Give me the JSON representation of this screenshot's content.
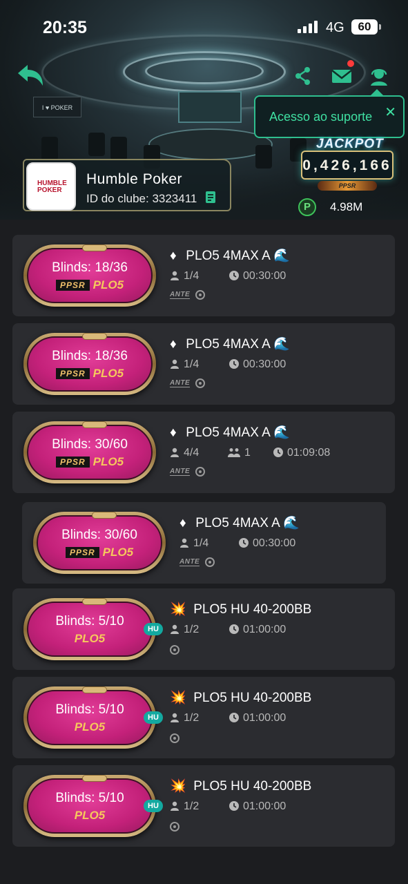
{
  "status_bar": {
    "time": "20:35",
    "network": "4G",
    "battery": "60"
  },
  "header": {
    "support_popup": "Acesso ao suporte",
    "jackpot": {
      "title": "JACKPOT",
      "value": "0,426,166",
      "badge": "PPSR"
    },
    "club": {
      "logo_line1": "HUMBLE",
      "logo_line2": "POKER",
      "name": "Humble  Poker",
      "id_label": "ID do clube: 3323411"
    },
    "balance": "4.98M",
    "icons": [
      "back-arrow-icon",
      "share-icon",
      "mail-icon",
      "support-agent-icon",
      "coin-icon"
    ],
    "accent_color": "#2fbf8f"
  },
  "tables": [
    {
      "blinds": "Blinds: 18/36",
      "ppsr": "PPSR",
      "game": "PLO5",
      "name": "PLO5 4MAX A",
      "icon": "diamond",
      "emoji": "🌊",
      "players": "1/4",
      "waiting": "",
      "time": "00:30:00",
      "ante": "ANTE",
      "hu": ""
    },
    {
      "blinds": "Blinds: 18/36",
      "ppsr": "PPSR",
      "game": "PLO5",
      "name": "PLO5 4MAX A",
      "icon": "diamond",
      "emoji": "🌊",
      "players": "1/4",
      "waiting": "",
      "time": "00:30:00",
      "ante": "ANTE",
      "hu": ""
    },
    {
      "blinds": "Blinds: 30/60",
      "ppsr": "PPSR",
      "game": "PLO5",
      "name": "PLO5 4MAX A",
      "icon": "diamond",
      "emoji": "🌊",
      "players": "4/4",
      "waiting": "1",
      "time": "01:09:08",
      "ante": "ANTE",
      "hu": ""
    },
    {
      "blinds": "Blinds: 30/60",
      "ppsr": "PPSR",
      "game": "PLO5",
      "name": "PLO5 4MAX A",
      "icon": "diamond",
      "emoji": "🌊",
      "players": "1/4",
      "waiting": "",
      "time": "00:30:00",
      "ante": "ANTE",
      "hu": ""
    },
    {
      "blinds": "Blinds: 5/10",
      "ppsr": "",
      "game": "PLO5",
      "name": "PLO5 HU 40-200BB",
      "icon": "burst",
      "emoji": "💥",
      "players": "1/2",
      "waiting": "",
      "time": "01:00:00",
      "ante": "",
      "hu": "HU"
    },
    {
      "blinds": "Blinds: 5/10",
      "ppsr": "",
      "game": "PLO5",
      "name": "PLO5 HU 40-200BB",
      "icon": "burst",
      "emoji": "💥",
      "players": "1/2",
      "waiting": "",
      "time": "01:00:00",
      "ante": "",
      "hu": "HU"
    },
    {
      "blinds": "Blinds: 5/10",
      "ppsr": "",
      "game": "PLO5",
      "name": "PLO5 HU 40-200BB",
      "icon": "burst",
      "emoji": "💥",
      "players": "1/2",
      "waiting": "",
      "time": "01:00:00",
      "ante": "",
      "hu": "HU"
    }
  ]
}
